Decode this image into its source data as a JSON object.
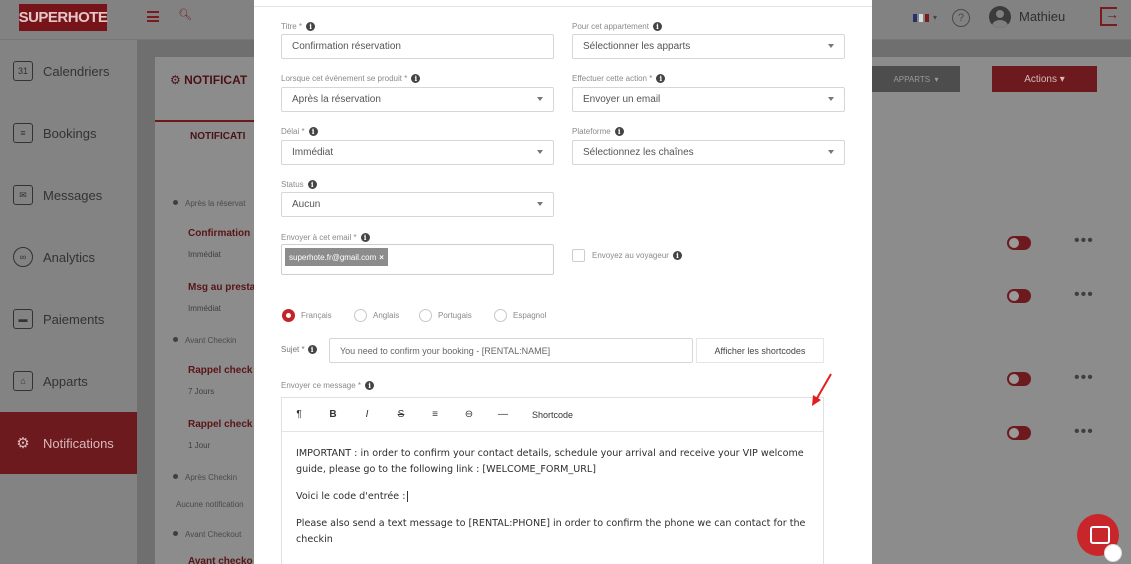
{
  "app": {
    "logo": "SUPERHOTE",
    "user_name": "Mathieu"
  },
  "sidebar": {
    "items": [
      {
        "label": "Calendriers",
        "icon": "calendar-icon"
      },
      {
        "label": "Bookings",
        "icon": "bookings-icon"
      },
      {
        "label": "Messages",
        "icon": "mail-icon"
      },
      {
        "label": "Analytics",
        "icon": "analytics-icon"
      },
      {
        "label": "Paiements",
        "icon": "payment-icon"
      },
      {
        "label": "Apparts",
        "icon": "apartment-icon"
      },
      {
        "label": "Notifications",
        "icon": "gears-icon",
        "active": true
      }
    ]
  },
  "background": {
    "page_title": "NOTIFICAT",
    "tab": "NOTIFICATI",
    "apparts_btn": "APPARTS",
    "actions_btn": "Actions",
    "timeline": [
      {
        "section": "Après la réservat"
      },
      {
        "title": "Confirmation",
        "sub": "Immédiat"
      },
      {
        "title": "Msg au presta",
        "sub": "Immédiat"
      },
      {
        "section": "Avant Checkin"
      },
      {
        "title": "Rappel check",
        "sub": "7 Jours"
      },
      {
        "title": "Rappel check",
        "sub": "1 Jour"
      },
      {
        "section": "Après Checkin"
      },
      {
        "note": "Aucune notification"
      },
      {
        "section": "Avant Checkout"
      },
      {
        "title": "Avant checko"
      }
    ]
  },
  "form": {
    "title_label": "Titre *",
    "title_value": "Confirmation réservation",
    "appart_label": "Pour cet appartement",
    "appart_value": "Sélectionner les apparts",
    "event_label": "Lorsque cet événement se produit *",
    "event_value": "Après la réservation",
    "action_label": "Effectuer cette action *",
    "action_value": "Envoyer un email",
    "delay_label": "Délai *",
    "delay_value": "Immédiat",
    "platform_label": "Plateforme",
    "platform_value": "Sélectionnez les chaînes",
    "status_label": "Status",
    "status_value": "Aucun",
    "email_label": "Envoyer à cet email *",
    "email_chip": "superhote.fr@gmail.com",
    "traveler_label": "Envoyez au voyageur",
    "languages": [
      "Français",
      "Anglais",
      "Portugais",
      "Espagnol"
    ],
    "subject_label": "Sujet *",
    "subject_value": "You need to confirm your booking - [RENTAL:NAME]",
    "shortcodes_btn": "Afficher les shortcodes",
    "message_label": "Envoyer ce message *",
    "toolbar": [
      "¶",
      "B",
      "I",
      "S",
      "≡",
      "⊖",
      "—"
    ],
    "shortcode_btn": "Shortcode",
    "body": [
      "IMPORTANT : in order to confirm your contact details, schedule your arrival and receive your VIP welcome guide, please go to the following link : [WELCOME_FORM_URL]",
      "Voici le code d'entrée :",
      "Please also send a text message to [RENTAL:PHONE] in order to confirm the phone we can contact for the checkin"
    ]
  },
  "colors": {
    "brand": "#c2242a",
    "overlay": "#6f6f6f"
  }
}
